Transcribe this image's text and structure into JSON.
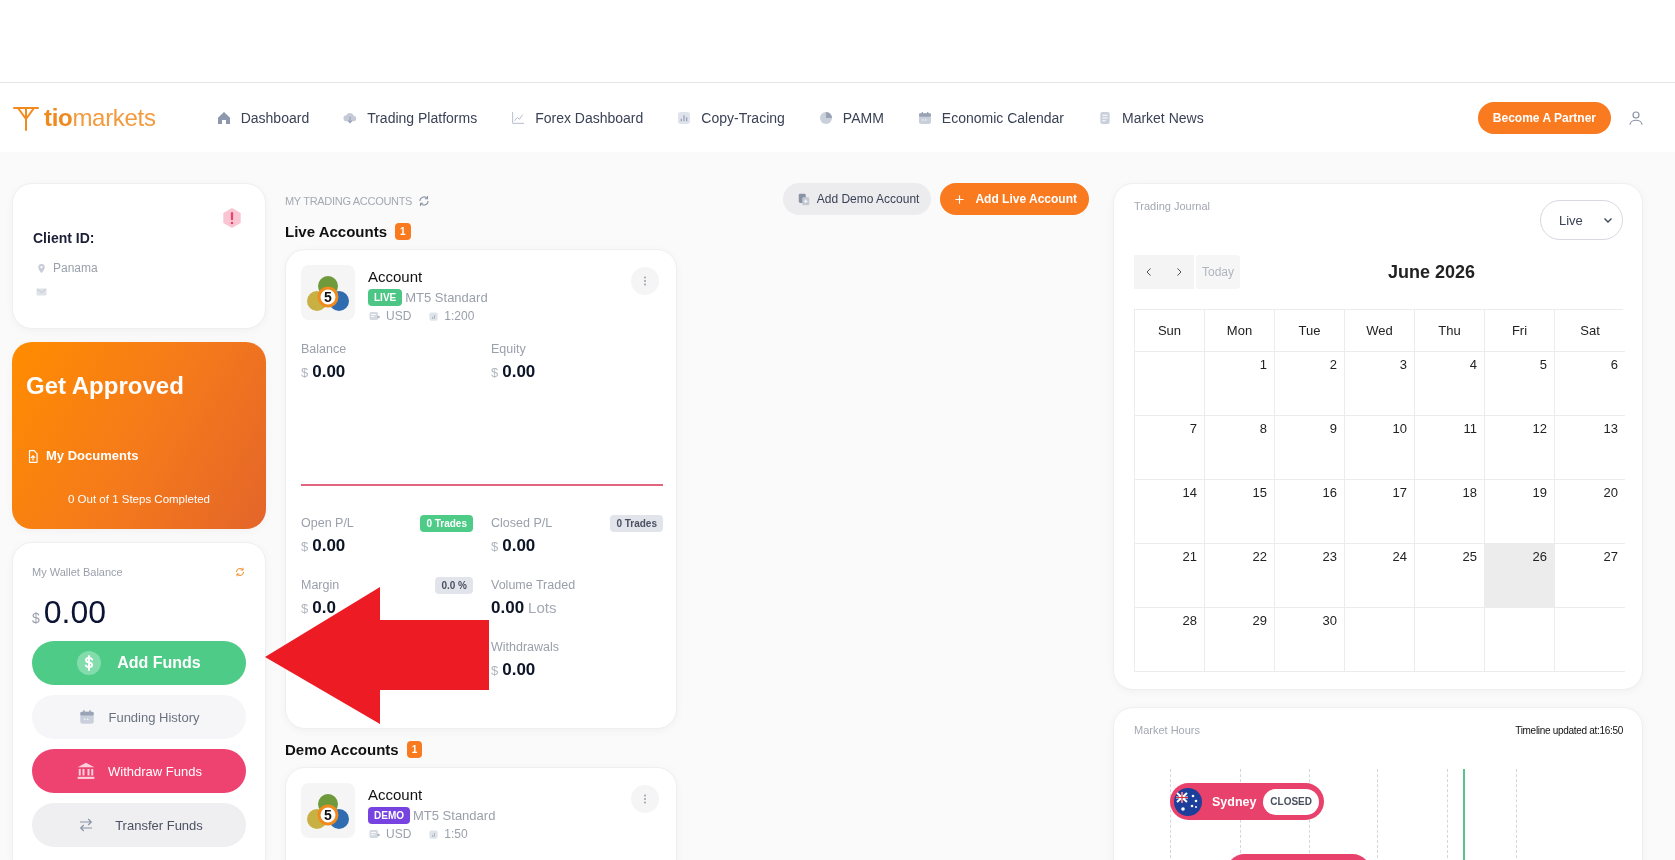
{
  "header": {
    "logo": "**tio**markets",
    "nav": [
      {
        "label": "Dashboard"
      },
      {
        "label": "Trading Platforms"
      },
      {
        "label": "Forex Dashboard"
      },
      {
        "label": "Copy-Tracing"
      },
      {
        "label": "PAMM"
      },
      {
        "label": "Economic Calendar"
      },
      {
        "label": "Market News"
      }
    ],
    "partner_button": "Become A Partner"
  },
  "client_card": {
    "title": "Client ID:",
    "location": "Panama"
  },
  "approval": {
    "title": "Get Approved",
    "documents_link": "My Documents",
    "progress": "0 Out of 1 Steps Completed"
  },
  "wallet": {
    "title": "My Wallet Balance",
    "currency": "$",
    "amount": "0.00",
    "buttons": [
      {
        "label": "Add Funds",
        "kind": "deposit"
      },
      {
        "label": "Funding History",
        "kind": "history"
      },
      {
        "label": "Withdraw Funds",
        "kind": "withdraw"
      },
      {
        "label": "Transfer Funds",
        "kind": "transfer"
      }
    ]
  },
  "trading_accounts": {
    "title": "MY TRADING ACCOUNTS",
    "actions": [
      {
        "label": "Add Demo Account",
        "kind": "demo"
      },
      {
        "label": "Add Live Account",
        "kind": "live"
      }
    ],
    "groups": [
      {
        "title": "Live Accounts",
        "count": "1",
        "accounts": [
          {
            "name": "Account",
            "logo_mark": "5",
            "badge": {
              "label": "LIVE",
              "color": "#4cc685"
            },
            "platform": "MT5 Standard",
            "currency": "USD",
            "leverage": "1:200",
            "summary": [
              {
                "left": {
                  "label": "Balance",
                  "currency": "$",
                  "value": "0.00"
                },
                "right": {
                  "label": "Equity",
                  "currency": "$",
                  "value": "0.00"
                }
              }
            ],
            "details": [
              {
                "left": {
                  "label": "Open P/L",
                  "tag": {
                    "text": "0 Trades",
                    "kind": "success"
                  },
                  "currency": "$",
                  "value": "0.00"
                },
                "right": {
                  "label": "Closed P/L",
                  "tag": {
                    "text": "0 Trades",
                    "kind": "neutral"
                  },
                  "currency": "$",
                  "value": "0.00"
                }
              },
              {
                "left": {
                  "label": "Margin",
                  "tag": {
                    "text": "0.0 %",
                    "kind": "neutral"
                  },
                  "currency": "$",
                  "value": "0.0"
                },
                "right": {
                  "label": "Volume Traded",
                  "value": "0.00",
                  "unit": "Lots"
                }
              },
              {
                "right": {
                  "label": "Withdrawals",
                  "currency": "$",
                  "value": "0.00"
                }
              }
            ]
          }
        ]
      },
      {
        "title": "Demo Accounts",
        "count": "1",
        "accounts": [
          {
            "name": "Account",
            "logo_mark": "5",
            "badge": {
              "label": "DEMO",
              "color": "#7643e0"
            },
            "platform": "MT5 Standard",
            "currency": "USD",
            "leverage": "1:50"
          }
        ]
      }
    ]
  },
  "journal": {
    "title": "Trading Journal",
    "filter": "Live",
    "today_button": "Today",
    "month": "June 2026",
    "weekdays": [
      "Sun",
      "Mon",
      "Tue",
      "Wed",
      "Thu",
      "Fri",
      "Sat"
    ],
    "weeks": [
      [
        {
          "label": "1",
          "today": false
        },
        {
          "label": "2",
          "today": false
        },
        {
          "label": "3",
          "today": false
        },
        {
          "label": "4",
          "today": false
        },
        {
          "label": "5",
          "today": false
        },
        {
          "label": "6",
          "today": false
        }
      ],
      [
        {
          "label": "7",
          "today": false
        },
        {
          "label": "8",
          "today": false
        },
        {
          "label": "9",
          "today": false
        },
        {
          "label": "10",
          "today": false
        },
        {
          "label": "11",
          "today": false
        },
        {
          "label": "12",
          "today": false
        },
        {
          "label": "13",
          "today": false
        }
      ],
      [
        {
          "label": "14",
          "today": false
        },
        {
          "label": "15",
          "today": false
        },
        {
          "label": "16",
          "today": false
        },
        {
          "label": "17",
          "today": false
        },
        {
          "label": "18",
          "today": false
        },
        {
          "label": "19",
          "today": false
        },
        {
          "label": "20",
          "today": false
        }
      ],
      [
        {
          "label": "21",
          "today": false
        },
        {
          "label": "22",
          "today": false
        },
        {
          "label": "23",
          "today": false
        },
        {
          "label": "24",
          "today": false
        },
        {
          "label": "25",
          "today": false
        },
        {
          "label": "26",
          "today": true
        },
        {
          "label": "27",
          "today": false
        }
      ],
      [
        {
          "label": "28",
          "today": false
        },
        {
          "label": "29",
          "today": false
        },
        {
          "label": "30",
          "today": false
        }
      ]
    ]
  },
  "market_hours": {
    "title": "Market Hours",
    "updated": "Timeline updated at:16:50",
    "sessions": [
      {
        "name": "Sydney",
        "status": "CLOSED"
      }
    ]
  }
}
